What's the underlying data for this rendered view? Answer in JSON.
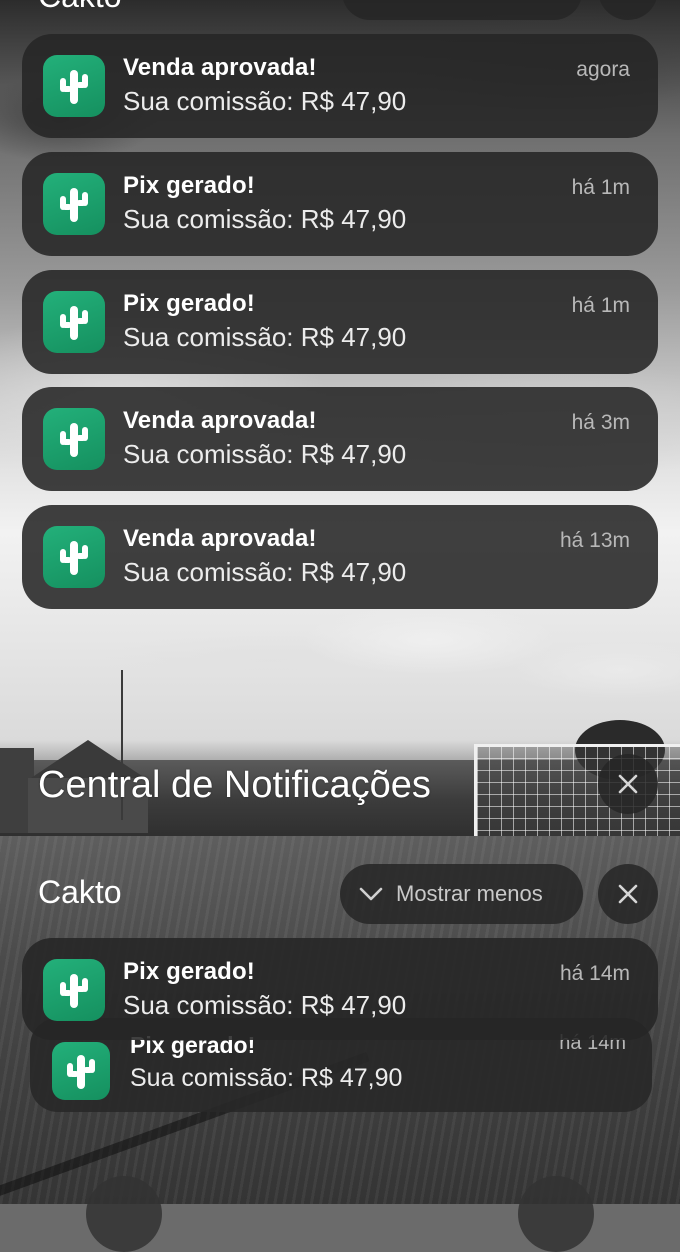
{
  "header": {
    "app_label": "Cakto"
  },
  "notifications": [
    {
      "title": "Venda aprovada!",
      "body": "Sua comissão: R$ 47,90",
      "time": "agora"
    },
    {
      "title": "Pix gerado!",
      "body": "Sua comissão: R$ 47,90",
      "time": "há 1m"
    },
    {
      "title": "Pix gerado!",
      "body": "Sua comissão: R$ 47,90",
      "time": "há 1m"
    },
    {
      "title": "Venda aprovada!",
      "body": "Sua comissão: R$ 47,90",
      "time": "há 3m"
    },
    {
      "title": "Venda aprovada!",
      "body": "Sua comissão: R$ 47,90",
      "time": "há 13m"
    }
  ],
  "notification_center": {
    "title": "Central de Notificações",
    "close_icon": "close-icon"
  },
  "group": {
    "label": "Cakto",
    "show_less_label": "Mostrar menos",
    "chevron_icon": "chevron-down-icon",
    "close_icon": "close-icon",
    "notifications": [
      {
        "title": "Pix gerado!",
        "body": "Sua comissão: R$ 47,90",
        "time": "há 14m"
      },
      {
        "title": "Pix gerado!",
        "body": "Sua comissão: R$ 47,90",
        "time": "há 14m"
      }
    ]
  },
  "colors": {
    "app_icon": "#1fa571",
    "card_bg": "#262626",
    "text_primary": "#ffffff",
    "text_secondary": "#b8b8b8"
  }
}
